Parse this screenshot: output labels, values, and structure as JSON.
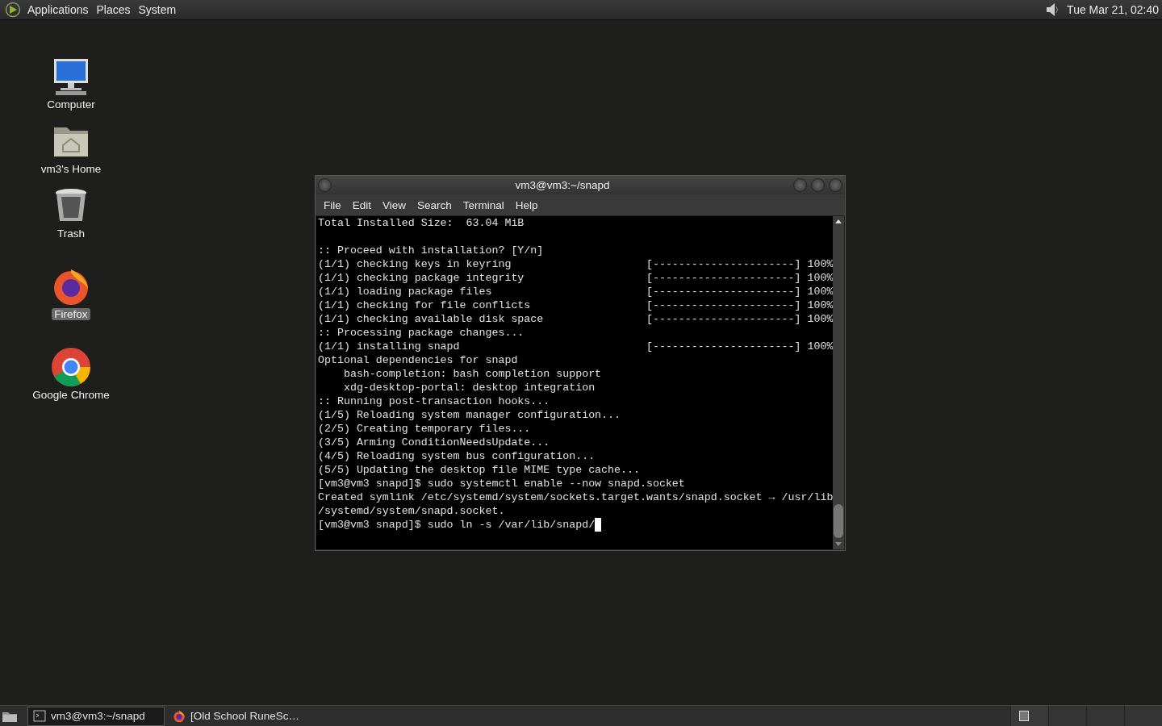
{
  "top_panel": {
    "menus": [
      "Applications",
      "Places",
      "System"
    ],
    "clock": "Tue Mar 21, 02:40"
  },
  "desktop_icons": [
    {
      "kind": "computer",
      "label": "Computer",
      "selected": false
    },
    {
      "kind": "home",
      "label": "vm3's Home",
      "selected": false
    },
    {
      "kind": "trash",
      "label": "Trash",
      "selected": false
    },
    {
      "kind": "firefox",
      "label": "Firefox",
      "selected": true
    },
    {
      "kind": "chrome",
      "label": "Google Chrome",
      "selected": false
    }
  ],
  "terminal": {
    "title": "vm3@vm3:~/snapd",
    "menus": [
      "File",
      "Edit",
      "View",
      "Search",
      "Terminal",
      "Help"
    ],
    "lines": [
      {
        "text": "Total Installed Size:  63.04 MiB"
      },
      {
        "kind": "blank"
      },
      {
        "text": ":: Proceed with installation? [Y/n]"
      },
      {
        "text": "(1/1) checking keys in keyring                     [----------------------] 100%"
      },
      {
        "text": "(1/1) checking package integrity                   [----------------------] 100%"
      },
      {
        "text": "(1/1) loading package files                        [----------------------] 100%"
      },
      {
        "text": "(1/1) checking for file conflicts                  [----------------------] 100%"
      },
      {
        "text": "(1/1) checking available disk space                [----------------------] 100%"
      },
      {
        "text": ":: Processing package changes..."
      },
      {
        "text": "(1/1) installing snapd                             [----------------------] 100%"
      },
      {
        "text": "Optional dependencies for snapd"
      },
      {
        "text": "    bash-completion: bash completion support"
      },
      {
        "text": "    xdg-desktop-portal: desktop integration"
      },
      {
        "text": ":: Running post-transaction hooks..."
      },
      {
        "text": "(1/5) Reloading system manager configuration..."
      },
      {
        "text": "(2/5) Creating temporary files..."
      },
      {
        "text": "(3/5) Arming ConditionNeedsUpdate..."
      },
      {
        "text": "(4/5) Reloading system bus configuration..."
      },
      {
        "text": "(5/5) Updating the desktop file MIME type cache..."
      },
      {
        "text": "[vm3@vm3 snapd]$ sudo systemctl enable --now snapd.socket"
      },
      {
        "text": "Created symlink /etc/systemd/system/sockets.target.wants/snapd.socket → /usr/lib"
      },
      {
        "text": "/systemd/system/snapd.socket."
      },
      {
        "text": "[vm3@vm3 snapd]$ sudo ln -s /var/lib/snapd/",
        "cursor": true
      }
    ]
  },
  "taskbar": [
    {
      "kind": "terminal",
      "label": "vm3@vm3:~/snapd",
      "selected": true
    },
    {
      "kind": "firefox",
      "label": "[Old School RuneSc…",
      "selected": false
    }
  ]
}
